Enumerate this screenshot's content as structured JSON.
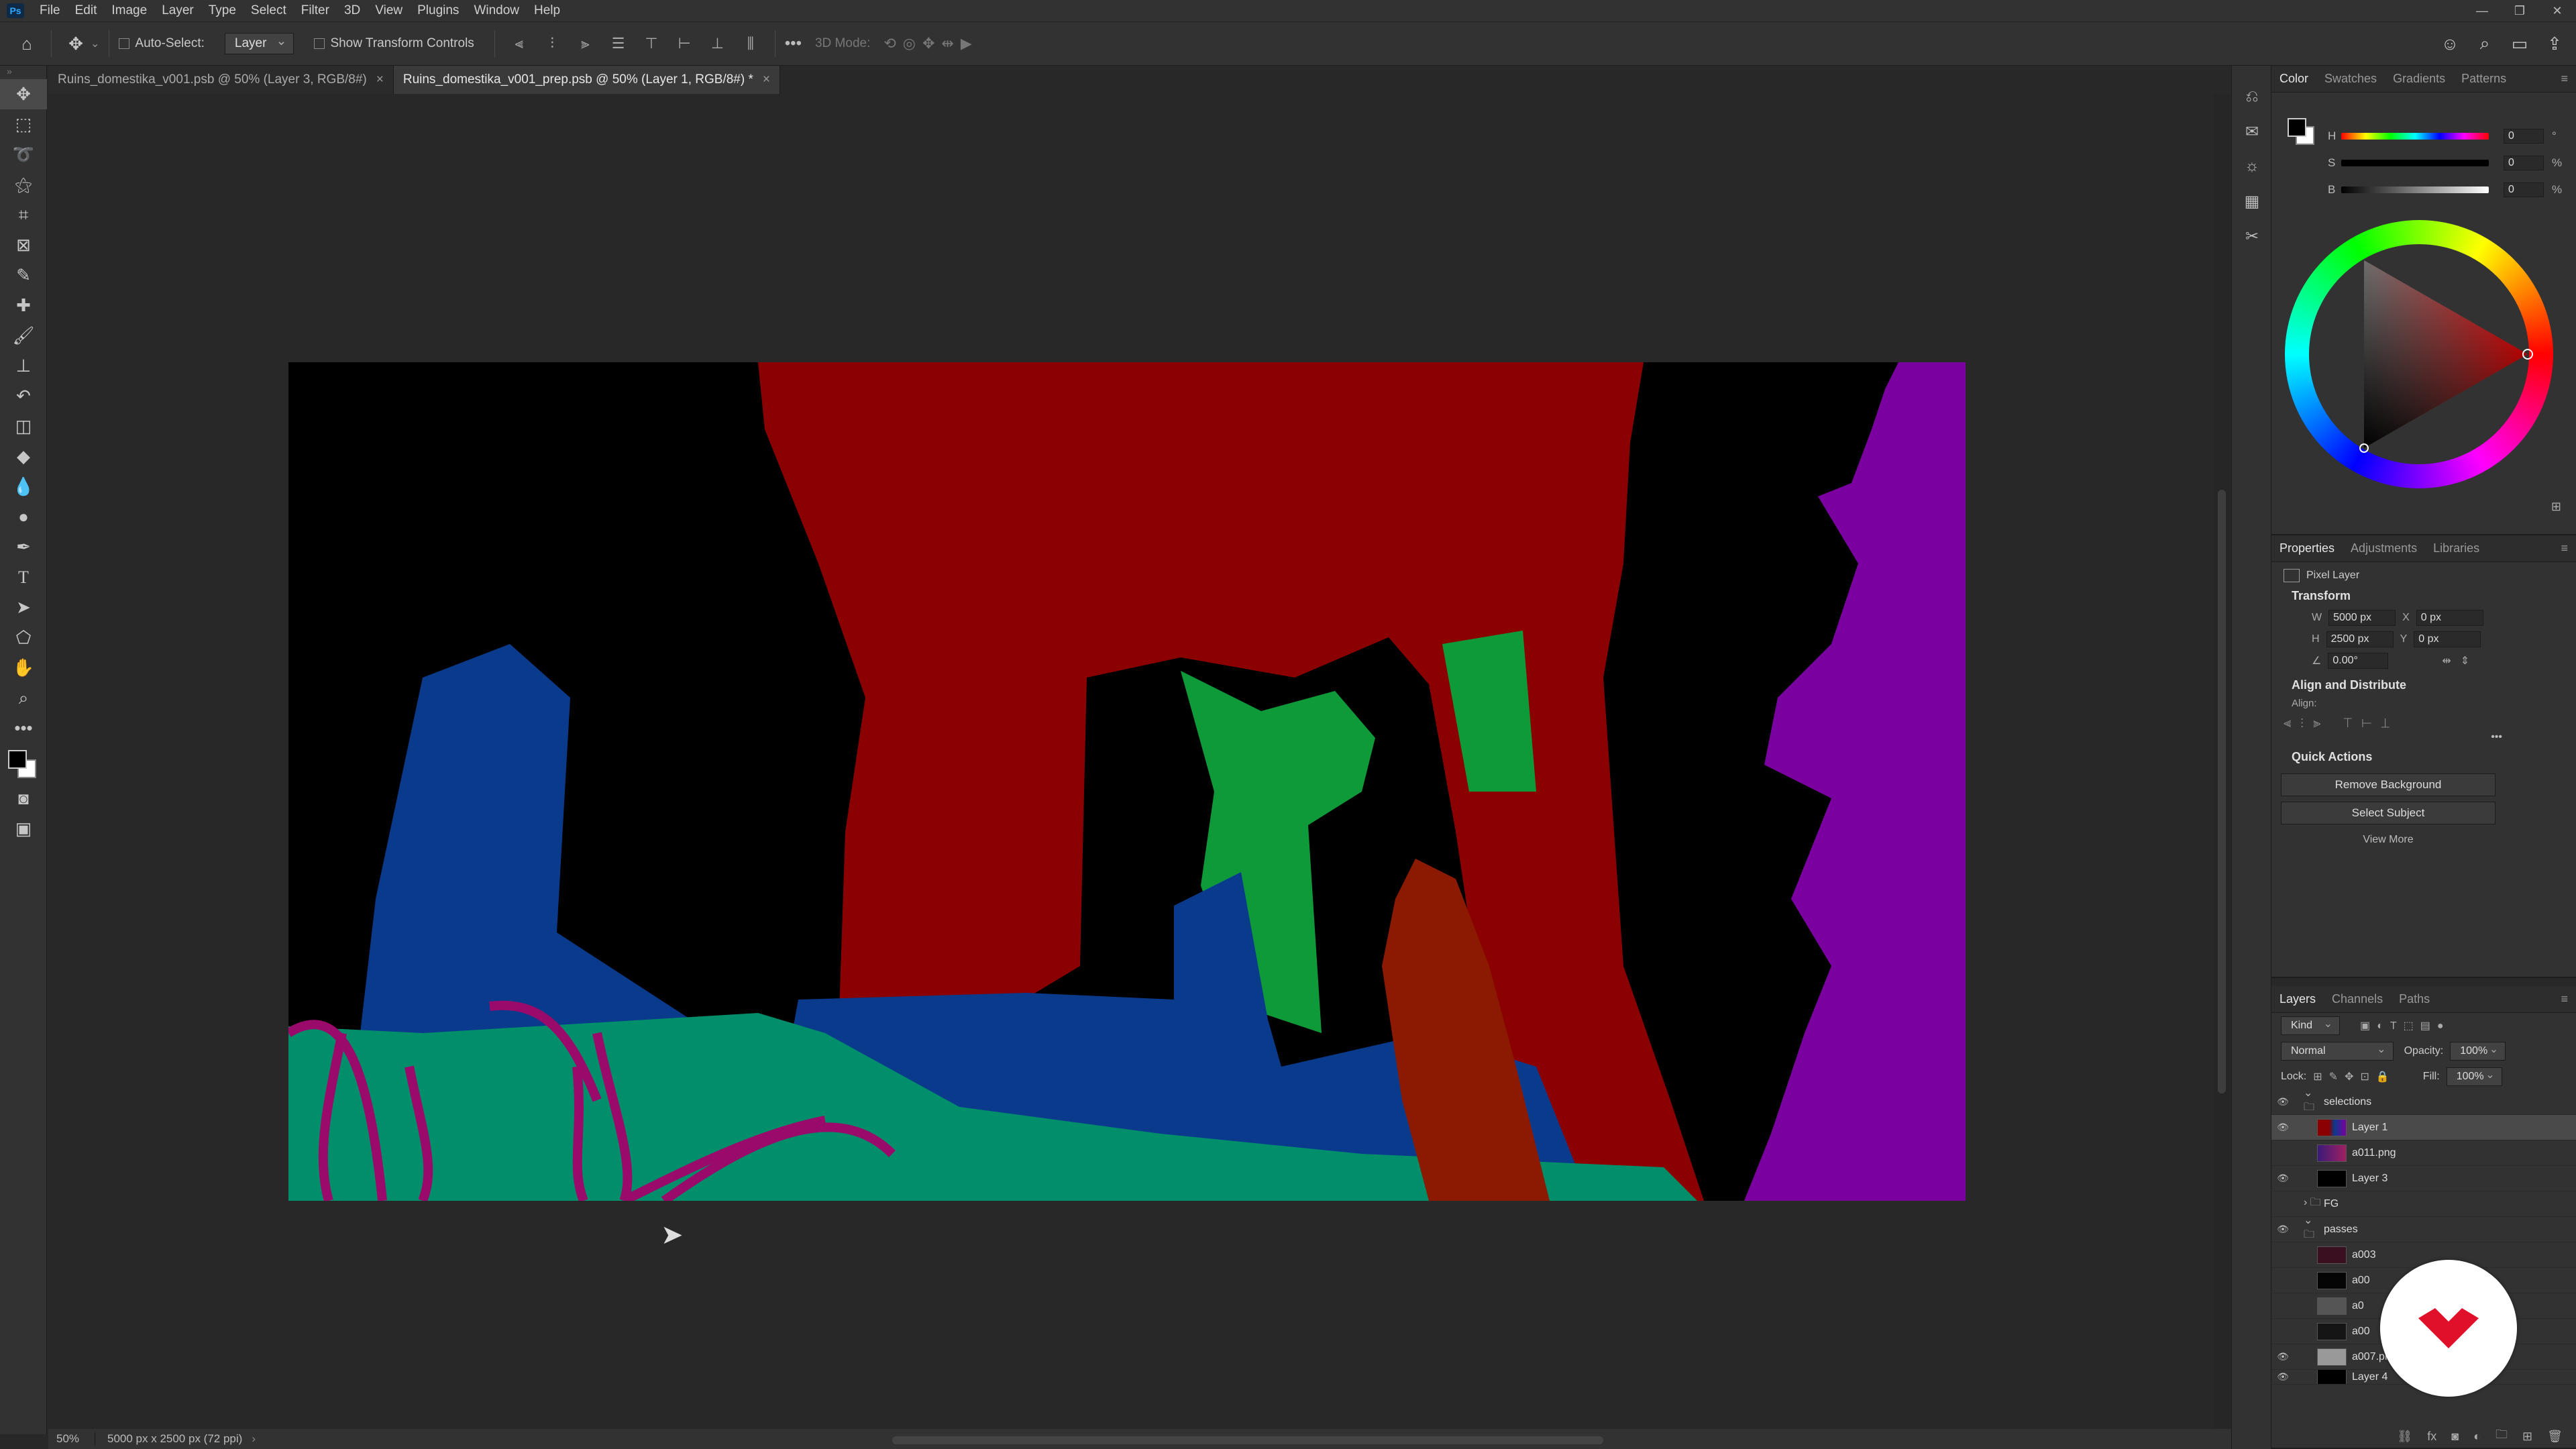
{
  "menubar": {
    "items": [
      "File",
      "Edit",
      "Image",
      "Layer",
      "Type",
      "Select",
      "Filter",
      "3D",
      "View",
      "Plugins",
      "Window",
      "Help"
    ]
  },
  "options": {
    "auto_select_label": "Auto-Select:",
    "auto_select_value": "Layer",
    "show_transform_label": "Show Transform Controls",
    "mode_3d_label": "3D Mode:"
  },
  "tabs": [
    {
      "label": "Ruins_domestika_v001.psb @ 50% (Layer 3, RGB/8#)"
    },
    {
      "label": "Ruins_domestika_v001_prep.psb @ 50% (Layer 1, RGB/8#) *"
    }
  ],
  "status": {
    "zoom": "50%",
    "doc_info": "5000 px x 2500 px (72 ppi)"
  },
  "color_panel": {
    "tabs": [
      "Color",
      "Swatches",
      "Gradients",
      "Patterns"
    ],
    "h": {
      "label": "H",
      "value": "0",
      "unit": "°"
    },
    "s": {
      "label": "S",
      "value": "0",
      "unit": "%"
    },
    "b": {
      "label": "B",
      "value": "0",
      "unit": "%"
    }
  },
  "properties": {
    "tabs": [
      "Properties",
      "Adjustments",
      "Libraries"
    ],
    "layer_type": "Pixel Layer",
    "transform_title": "Transform",
    "w": "5000 px",
    "h": "2500 px",
    "x": "0 px",
    "y": "0 px",
    "angle": "0.00°",
    "align_title": "Align and Distribute",
    "align_label": "Align:",
    "quick_title": "Quick Actions",
    "btn_remove_bg": "Remove Background",
    "btn_select_subject": "Select Subject",
    "view_more": "View More"
  },
  "layers_panel": {
    "tabs": [
      "Layers",
      "Channels",
      "Paths"
    ],
    "kind": "Kind",
    "blend": "Normal",
    "opacity_label": "Opacity:",
    "opacity": "100%",
    "lock_label": "Lock:",
    "fill_label": "Fill:",
    "fill": "100%",
    "layers": [
      {
        "name": "selections",
        "type": "group",
        "visible": true
      },
      {
        "name": "Layer 1",
        "type": "layer",
        "visible": true,
        "selected": true
      },
      {
        "name": "a011.png",
        "type": "layer",
        "visible": false
      },
      {
        "name": "Layer 3",
        "type": "layer",
        "visible": true
      },
      {
        "name": "FG",
        "type": "group",
        "visible": false
      },
      {
        "name": "passes",
        "type": "group",
        "visible": true
      },
      {
        "name": "a003",
        "type": "layer",
        "visible": false
      },
      {
        "name": "a00",
        "type": "layer",
        "visible": false
      },
      {
        "name": "a0",
        "type": "layer",
        "visible": false
      },
      {
        "name": "a00",
        "type": "layer",
        "visible": false
      },
      {
        "name": "a007.png",
        "type": "layer",
        "visible": true
      },
      {
        "name": "Layer 4",
        "type": "layer",
        "visible": true
      }
    ]
  },
  "colors": {
    "canvas_bg": "#000000",
    "red": "#8b0000",
    "blue": "#0a3a8c",
    "green": "#0f9a3a",
    "teal": "#008f6a",
    "purple": "#7a00a0",
    "orange_red": "#8b1a00",
    "magenta": "#9a0a6a"
  }
}
